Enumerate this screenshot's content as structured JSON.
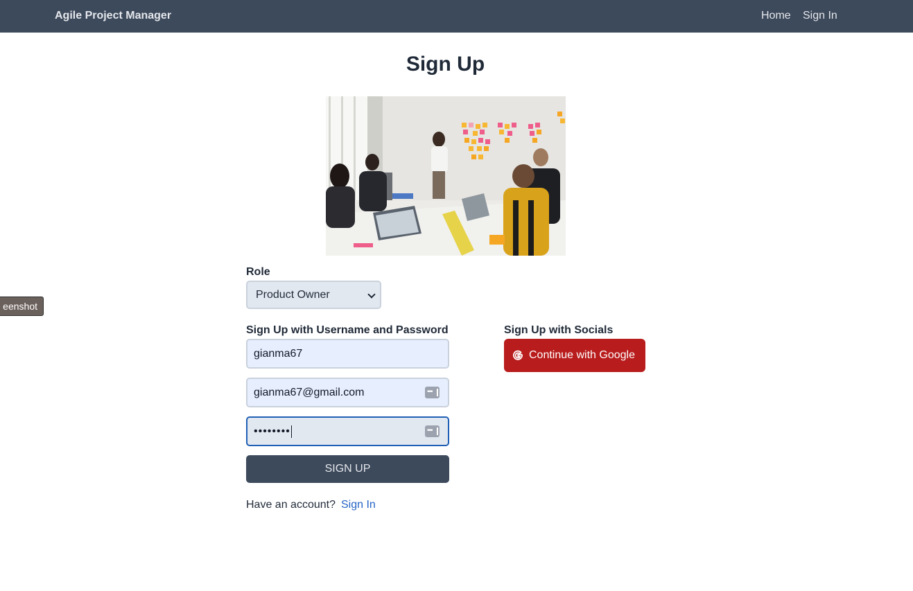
{
  "navbar": {
    "brand": "Agile Project Manager",
    "links": [
      "Home",
      "Sign In"
    ]
  },
  "side_tab": {
    "text": "eenshot"
  },
  "page": {
    "title": "Sign Up"
  },
  "role": {
    "label": "Role",
    "selected": "Product Owner"
  },
  "credentials": {
    "label": "Sign Up with Username and Password",
    "username_value": "gianma67",
    "email_value": "gianma67@gmail.com",
    "password_masked": "••••••••",
    "submit_label": "SIGN UP",
    "have_account_text": "Have an account?",
    "signin_link": "Sign In"
  },
  "socials": {
    "label": "Sign Up with Socials",
    "google_label": "Continue with Google",
    "google_icon": "google-g-icon"
  },
  "colors": {
    "navbar": "#3d4a5c",
    "google": "#b91c1c",
    "link": "#2563c4",
    "focus_border": "#1f5fb5"
  }
}
